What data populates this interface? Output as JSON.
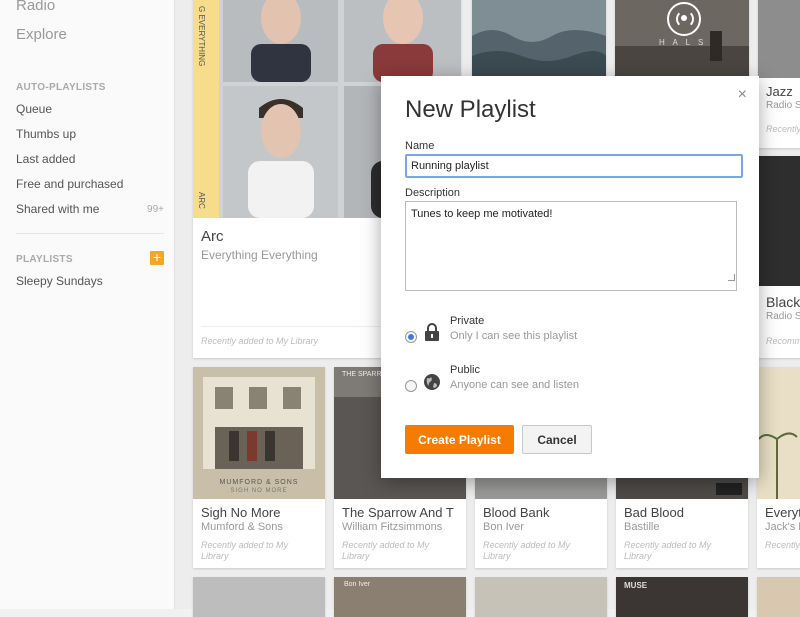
{
  "sidebar": {
    "nav": [
      "Radio",
      "Explore"
    ],
    "auto_header": "AUTO-PLAYLISTS",
    "auto_items": [
      "Queue",
      "Thumbs up",
      "Last added",
      "Free and purchased",
      "Shared with me"
    ],
    "shared_count": "99+",
    "playlists_header": "PLAYLISTS",
    "playlists": [
      "Sleepy Sundays"
    ]
  },
  "cards": {
    "arc": {
      "title": "Arc",
      "artist": "Everything Everything",
      "note": "Recently added to My Library",
      "spine_top": "G EVERYTHING",
      "spine_bottom": "ARC"
    },
    "jazz": {
      "title": "Jazz",
      "sub": "Radio S",
      "note": "Recently",
      "art_text": "H A L S"
    },
    "black": {
      "title": "Black",
      "sub": "Radio S",
      "note": "Recomm"
    },
    "row2": [
      {
        "title": "Sigh No More",
        "artist": "Mumford & Sons",
        "note": "Recently added to My Library",
        "art_text": "MUMFORD & SONS",
        "art_text2": "SIGH NO MORE"
      },
      {
        "title": "The Sparrow And T",
        "artist": "William Fitzsimmons",
        "note": "Recently added to My Library",
        "art_text": "THE SPARROW"
      },
      {
        "title": "Blood Bank",
        "artist": "Bon Iver",
        "note": "Recently added to My Library"
      },
      {
        "title": "Bad Blood",
        "artist": "Bastille",
        "note": "Recently added to My Library"
      },
      {
        "title": "Everyt",
        "artist": "Jack's M",
        "note": "Recently"
      }
    ],
    "row3_labels": [
      "Bon Iver",
      "MUSE"
    ]
  },
  "dialog": {
    "title": "New Playlist",
    "close": "×",
    "name_label": "Name",
    "name_value": "Running playlist",
    "desc_label": "Description",
    "desc_value": "Tunes to keep me motivated!",
    "private_title": "Private",
    "private_sub": "Only I can see this playlist",
    "public_title": "Public",
    "public_sub": "Anyone can see and listen",
    "create_label": "Create Playlist",
    "cancel_label": "Cancel"
  },
  "colors": {
    "accent": "#f57c00",
    "focus": "#7aa7e6",
    "spine": "#f7dc8c"
  }
}
